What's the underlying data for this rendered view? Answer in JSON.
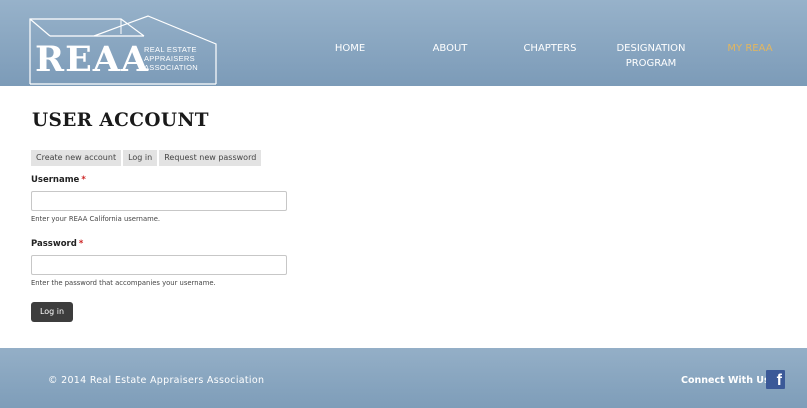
{
  "logo": {
    "text": "REAA",
    "line1": "REAL ESTATE",
    "line2": "APPRAISERS",
    "line3": "ASSOCIATION"
  },
  "nav": {
    "home": "HOME",
    "about": "ABOUT",
    "chapters": "CHAPTERS",
    "designation_line1": "DESIGNATION",
    "designation_line2": "PROGRAM",
    "my_reaa": "MY REAA",
    "active_color": "#e2b65f"
  },
  "page": {
    "title": "USER ACCOUNT"
  },
  "tabs": {
    "create": "Create new account",
    "login": "Log in",
    "request": "Request new password"
  },
  "form": {
    "username": {
      "label": "Username",
      "required_mark": "*",
      "value": "",
      "description": "Enter your REAA California username."
    },
    "password": {
      "label": "Password",
      "required_mark": "*",
      "value": "",
      "description": "Enter the password that accompanies your username."
    },
    "submit_label": "Log in"
  },
  "footer": {
    "copyright": "© 2014 Real Estate Appraisers Association",
    "connect": "Connect With Us",
    "facebook_glyph": "f"
  },
  "colors": {
    "header_bg": "#8aa7c2",
    "nav_active": "#e2b65f",
    "button_bg": "#3d3d3d",
    "required": "#cc2222",
    "facebook": "#3b5998"
  }
}
